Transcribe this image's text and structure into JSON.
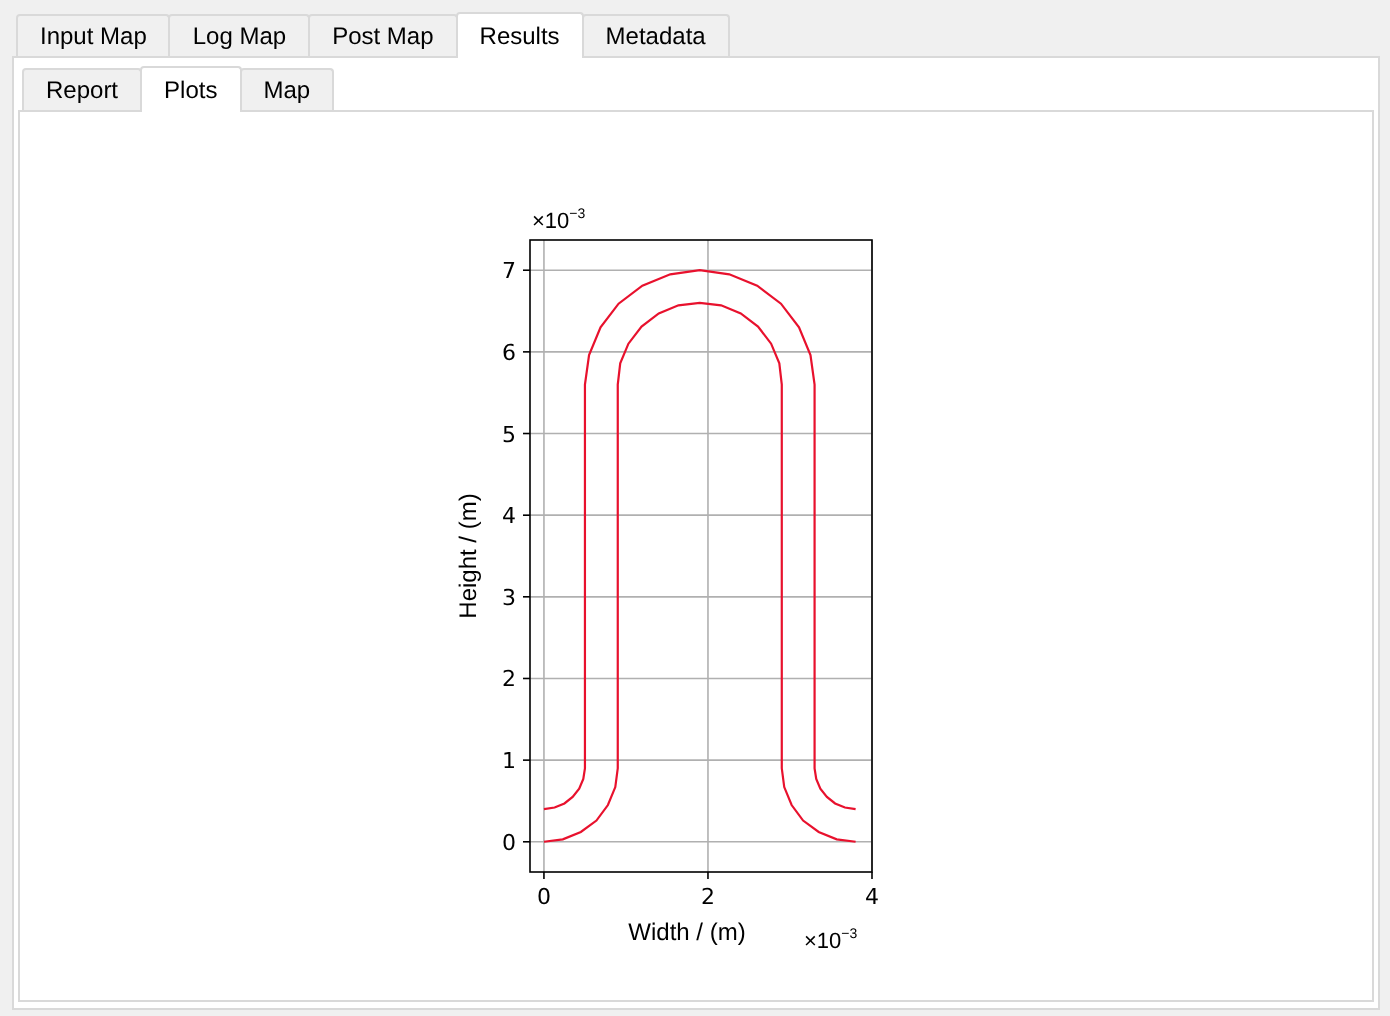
{
  "tabs": [
    {
      "label": "Input Map",
      "selected": false
    },
    {
      "label": "Log Map",
      "selected": false
    },
    {
      "label": "Post Map",
      "selected": false
    },
    {
      "label": "Results",
      "selected": true
    },
    {
      "label": "Metadata",
      "selected": false
    }
  ],
  "sub_tabs": [
    {
      "label": "Report",
      "selected": false
    },
    {
      "label": "Plots",
      "selected": true
    },
    {
      "label": "Map",
      "selected": false
    }
  ],
  "plot": {
    "x_offset": {
      "base": "×10",
      "exponent": "−3"
    },
    "y_offset": {
      "base": "×10",
      "exponent": "−3"
    },
    "chart_data": {
      "type": "line",
      "grid": true,
      "xlabel": "Width / (m)",
      "ylabel": "Height / (m)",
      "xlim": [
        -0.17,
        4
      ],
      "ylim": [
        -0.37,
        7.37
      ],
      "xticks": [
        0,
        2,
        4
      ],
      "yticks": [
        0,
        1,
        2,
        3,
        4,
        5,
        6,
        7
      ],
      "series": [
        {
          "color": "#e8112d",
          "x": [
            0,
            0.13,
            0.25,
            0.35,
            0.43,
            0.48,
            0.5,
            0.5,
            0.55,
            0.69,
            0.91,
            1.2,
            1.54,
            1.9,
            2.26,
            2.6,
            2.89,
            3.11,
            3.25,
            3.3,
            3.3,
            3.32,
            3.37,
            3.45,
            3.55,
            3.67,
            3.8
          ],
          "values": [
            0.4,
            0.42,
            0.47,
            0.55,
            0.65,
            0.77,
            0.9,
            5.6,
            5.96,
            6.3,
            6.59,
            6.81,
            6.95,
            7.0,
            6.95,
            6.81,
            6.59,
            6.3,
            5.96,
            5.6,
            0.9,
            0.77,
            0.65,
            0.55,
            0.47,
            0.42,
            0.4
          ]
        },
        {
          "color": "#e8112d",
          "x": [
            0,
            0.23,
            0.45,
            0.64,
            0.78,
            0.87,
            0.9,
            0.9,
            0.93,
            1.03,
            1.19,
            1.4,
            1.64,
            1.9,
            2.16,
            2.4,
            2.61,
            2.77,
            2.87,
            2.9,
            2.9,
            2.93,
            3.02,
            3.16,
            3.35,
            3.57,
            3.8
          ],
          "values": [
            0,
            0.03,
            0.12,
            0.26,
            0.45,
            0.67,
            0.9,
            5.6,
            5.86,
            6.1,
            6.31,
            6.47,
            6.57,
            6.6,
            6.57,
            6.47,
            6.31,
            6.1,
            5.86,
            5.6,
            0.9,
            0.67,
            0.45,
            0.26,
            0.12,
            0.03,
            0
          ]
        }
      ]
    }
  }
}
